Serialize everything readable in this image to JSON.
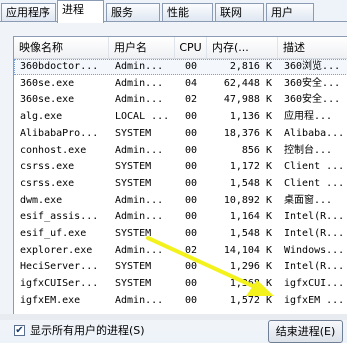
{
  "tabs": [
    "应用程序",
    "进程",
    "服务",
    "性能",
    "联网",
    "用户"
  ],
  "active_tab": "进程",
  "columns": [
    "映像名称",
    "用户名",
    "CPU",
    "内存(...",
    "描述"
  ],
  "processes": [
    {
      "name": "360bdoctor...",
      "user": "Admin...",
      "cpu": "00",
      "mem": "2,816 K",
      "desc": "360浏览..."
    },
    {
      "name": "360se.exe",
      "user": "Admin...",
      "cpu": "04",
      "mem": "62,448 K",
      "desc": "360安全..."
    },
    {
      "name": "360se.exe",
      "user": "Admin...",
      "cpu": "02",
      "mem": "47,988 K",
      "desc": "360安全..."
    },
    {
      "name": "alg.exe",
      "user": "LOCAL ...",
      "cpu": "00",
      "mem": "1,136 K",
      "desc": "应用程..."
    },
    {
      "name": "AlibabaPro...",
      "user": "SYSTEM",
      "cpu": "00",
      "mem": "18,376 K",
      "desc": "Alibaba..."
    },
    {
      "name": "conhost.exe",
      "user": "Admin...",
      "cpu": "00",
      "mem": "856 K",
      "desc": "控制台..."
    },
    {
      "name": "csrss.exe",
      "user": "SYSTEM",
      "cpu": "00",
      "mem": "1,172 K",
      "desc": "Client ..."
    },
    {
      "name": "csrss.exe",
      "user": "SYSTEM",
      "cpu": "00",
      "mem": "1,548 K",
      "desc": "Client ..."
    },
    {
      "name": "dwm.exe",
      "user": "Admin...",
      "cpu": "00",
      "mem": "10,892 K",
      "desc": "桌面窗..."
    },
    {
      "name": "esif_assis...",
      "user": "Admin...",
      "cpu": "00",
      "mem": "1,164 K",
      "desc": "Intel(R..."
    },
    {
      "name": "esif_uf.exe",
      "user": "SYSTEM",
      "cpu": "00",
      "mem": "1,548 K",
      "desc": "Intel(R..."
    },
    {
      "name": "explorer.exe",
      "user": "Admin...",
      "cpu": "02",
      "mem": "14,104 K",
      "desc": "Windows..."
    },
    {
      "name": "HeciServer...",
      "user": "SYSTEM",
      "cpu": "00",
      "mem": "1,296 K",
      "desc": "Intel(R..."
    },
    {
      "name": "igfxCUISer...",
      "user": "SYSTEM",
      "cpu": "00",
      "mem": "1,368 K",
      "desc": "igfxCUI..."
    },
    {
      "name": "igfxEM.exe",
      "user": "Admin...",
      "cpu": "00",
      "mem": "1,572 K",
      "desc": "igfxEM ..."
    }
  ],
  "show_all_users_label": "显示所有用户的进程(S)",
  "show_all_users_checked": "✔",
  "end_process_label": "结束进程(E)"
}
